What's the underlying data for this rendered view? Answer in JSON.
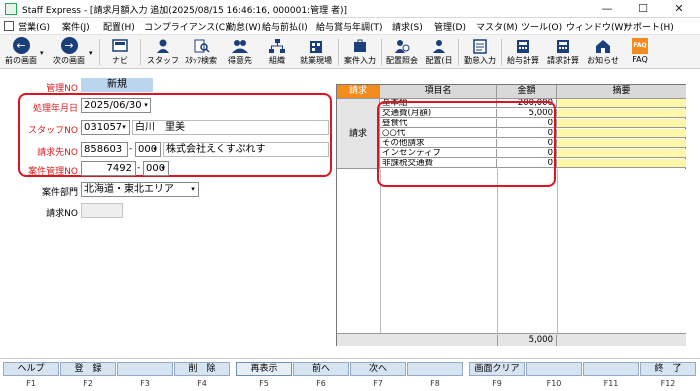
{
  "window": {
    "title": "Staff Express - [請求月額入力  追加(2025/08/15 16:46:16, 000001:管理  者)]",
    "minimize": "—",
    "maximize": "☐",
    "close": "✕"
  },
  "menu": [
    "営業(G)",
    "案件(J)",
    "配置(H)",
    "コンプライアンス(C)",
    "勤怠(W)",
    "給与前払(I)",
    "給与賞与年調(T)",
    "請求(S)",
    "管理(D)",
    "マスタ(M)",
    "ツール(O)",
    "ウィンドウ(W)",
    "サポート(H)"
  ],
  "toolbar": {
    "prev": "前の画面",
    "next": "次の画面",
    "nav": "ナビ",
    "staff": "スタッフ",
    "staff_search": "ｽﾀｯﾌ検索",
    "client": "得意先",
    "org": "組織",
    "site": "就業現場",
    "case_input": "案件入力",
    "assign_query": "配置照会",
    "assign_day": "配置(日",
    "attendance": "勤怠入力",
    "salary_calc": "給与計算",
    "billing_calc": "請求計算",
    "notice": "お知らせ",
    "faq": "FAQ",
    "faq_badge": "FAQ"
  },
  "form": {
    "kanri_no_label": "管理NO",
    "kanri_no_value": "新規",
    "shori_label": "処理年月日",
    "shori_value": "2025/06/30",
    "staff_label": "スタッフNO",
    "staff_no": "031057",
    "staff_name": "白川　里美",
    "seikyu_label": "請求先NO",
    "seikyu_no": "858603",
    "seikyu_sub": "000",
    "seikyu_name": "株式会社えくすぷれす",
    "anken_label": "案件管理NO",
    "anken_no": "7492",
    "anken_sub": "000",
    "bumon_label": "案件部門",
    "bumon_value": "北海道・東北エリア",
    "seikyu_no2_label": "請求NO",
    "seikyu_no2_value": "",
    "dash": "-"
  },
  "grid": {
    "headers": [
      "請求",
      "項目名",
      "金額",
      "摘要"
    ],
    "group_label": "請求",
    "rows": [
      {
        "name": "基本給",
        "amount": "200,000"
      },
      {
        "name": "交通費(月額)",
        "amount": "5,000"
      },
      {
        "name": "昼食代",
        "amount": "0"
      },
      {
        "name": "○○代",
        "amount": "0"
      },
      {
        "name": "その他請求",
        "amount": "0"
      },
      {
        "name": "インセンティブ",
        "amount": "0"
      },
      {
        "name": "非課税交通費",
        "amount": "0"
      }
    ],
    "total": "5,000"
  },
  "fkeys": [
    {
      "label": "ヘルプ",
      "key": "F1"
    },
    {
      "label": "登　録",
      "key": "F2"
    },
    {
      "label": "",
      "key": "F3"
    },
    {
      "label": "削　除",
      "key": "F4"
    },
    {
      "label": "再表示",
      "key": "F5"
    },
    {
      "label": "前へ",
      "key": "F6"
    },
    {
      "label": "次へ",
      "key": "F7"
    },
    {
      "label": "",
      "key": "F8"
    },
    {
      "label": "画面クリア",
      "key": "F9"
    },
    {
      "label": "",
      "key": "F10"
    },
    {
      "label": "",
      "key": "F11"
    },
    {
      "label": "終　了",
      "key": "F12"
    }
  ],
  "colors": {
    "accent_red": "#e0141e",
    "header_orange": "#f28c1e",
    "highlight_yellow": "#fff7a8",
    "new_blue": "#bcd5ee"
  }
}
